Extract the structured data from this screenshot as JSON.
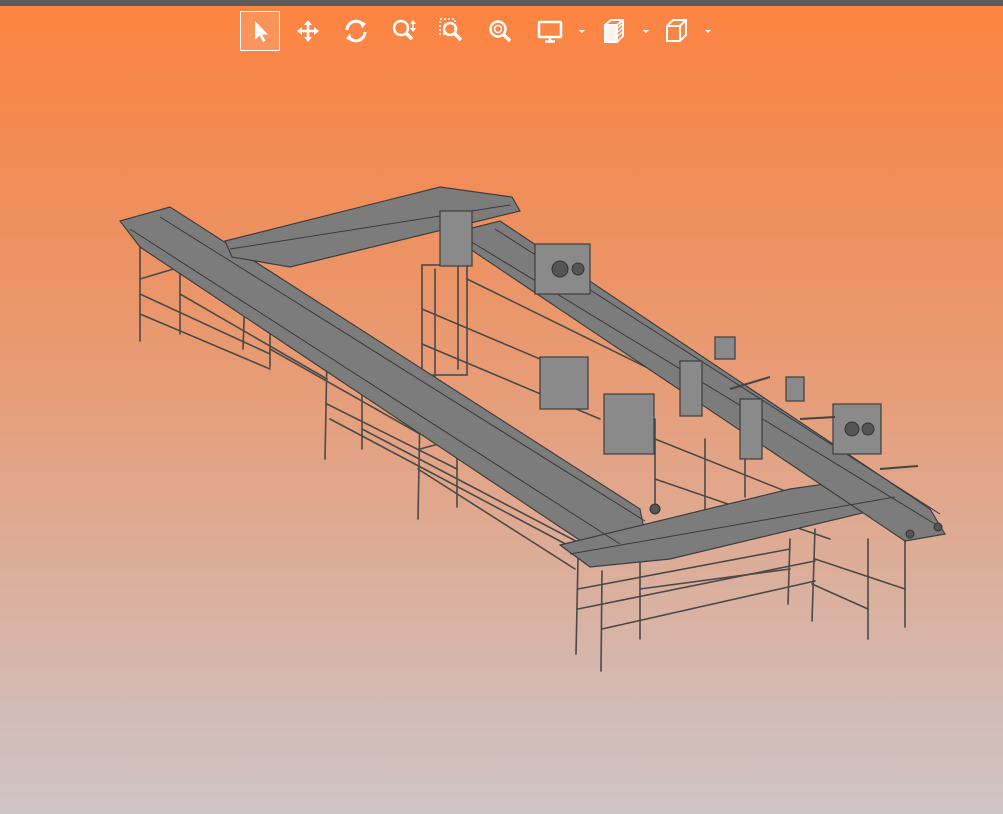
{
  "app": {
    "window_chrome": "dark-top-strip",
    "background": {
      "top": "#ff8340",
      "bottom": "#cfc4c4"
    }
  },
  "toolbar": {
    "tools": [
      {
        "id": "select",
        "icon": "cursor-arrow-icon",
        "active": true
      },
      {
        "id": "pan",
        "icon": "move-arrows-icon",
        "active": false
      },
      {
        "id": "rotate",
        "icon": "rotate-icon",
        "active": false
      },
      {
        "id": "zoom",
        "icon": "zoom-updown-icon",
        "active": false
      },
      {
        "id": "zoom-window",
        "icon": "zoom-window-icon",
        "active": false
      },
      {
        "id": "zoom-fit",
        "icon": "zoom-fit-icon",
        "active": false
      },
      {
        "id": "display",
        "icon": "monitor-icon",
        "has_dropdown": true
      },
      {
        "id": "section",
        "icon": "section-view-icon",
        "has_dropdown": true
      },
      {
        "id": "view-cube",
        "icon": "cube-view-icon",
        "has_dropdown": true
      }
    ],
    "icon_color": "#ffffff",
    "active_border": "#ffffff"
  },
  "viewport": {
    "model": "isometric-conveyor-frame-assembly",
    "line_color": "#4a4a4a",
    "surface_color": "#7c7c7c"
  }
}
